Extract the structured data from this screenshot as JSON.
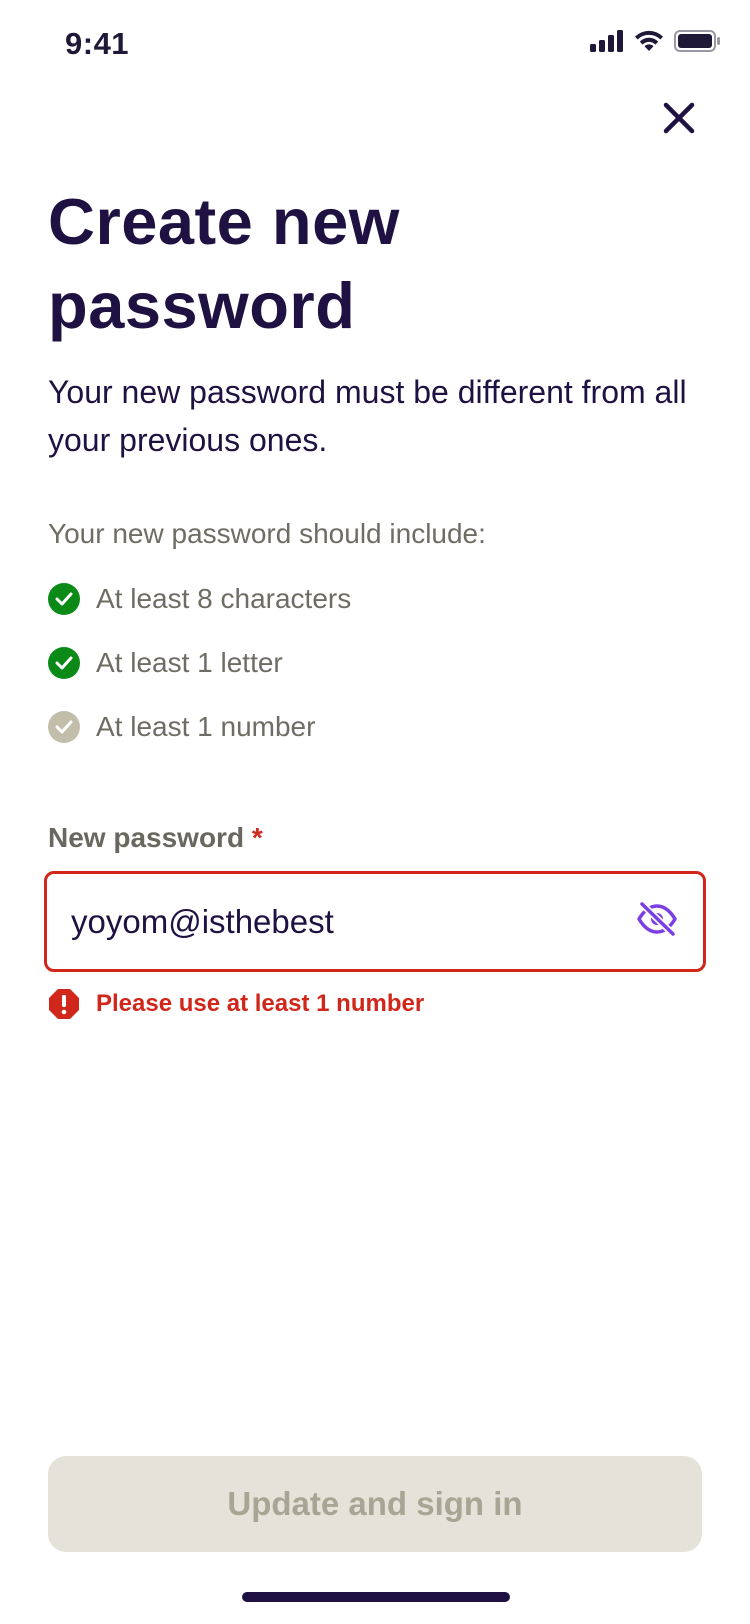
{
  "status_bar": {
    "time": "9:41"
  },
  "header": {
    "close_icon": "close-icon"
  },
  "title": "Create new password",
  "subtitle": "Your new password must be different from all your previous ones.",
  "requirements": {
    "heading": "Your new password should include:",
    "items": [
      {
        "label": "At least 8 characters",
        "met": true
      },
      {
        "label": "At least 1 letter",
        "met": true
      },
      {
        "label": "At least 1 number",
        "met": false
      }
    ]
  },
  "password_field": {
    "label": "New password",
    "required_mark": "*",
    "value": "yoyom@isthebest",
    "visibility_icon": "eye-slash-icon",
    "error": "Please use at least 1 number"
  },
  "submit": {
    "label": "Update and sign in"
  },
  "colors": {
    "primary_text": "#1f1141",
    "success": "#0b8a17",
    "pending": "#c3bea9",
    "error": "#d0271a",
    "accent": "#7b3fe4",
    "button_disabled_bg": "#e5e3d9",
    "button_disabled_text": "#a8a595"
  }
}
